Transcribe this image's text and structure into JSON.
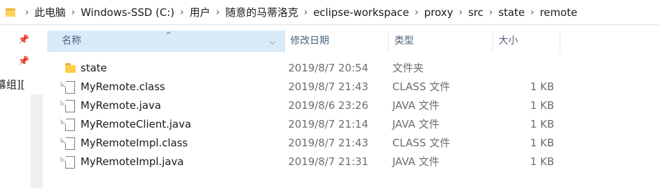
{
  "address_bar": {
    "crumbs": [
      "此电脑",
      "Windows-SSD (C:)",
      "用户",
      "随意的马蒂洛克",
      "eclipse-workspace",
      "proxy",
      "src",
      "state",
      "remote"
    ]
  },
  "nav_pane": {
    "label": "幕组]["
  },
  "columns": {
    "name": "名称",
    "date": "修改日期",
    "type": "类型",
    "size": "大小"
  },
  "files": [
    {
      "name": "state",
      "date": "2019/8/7 20:54",
      "type": "文件夹",
      "size": "",
      "icon": "folder-icon"
    },
    {
      "name": "MyRemote.class",
      "date": "2019/8/7 21:43",
      "type": "CLASS 文件",
      "size": "1 KB",
      "icon": "file-icon"
    },
    {
      "name": "MyRemote.java",
      "date": "2019/8/6 23:26",
      "type": "JAVA 文件",
      "size": "1 KB",
      "icon": "file-icon"
    },
    {
      "name": "MyRemoteClient.java",
      "date": "2019/8/7 21:14",
      "type": "JAVA 文件",
      "size": "1 KB",
      "icon": "file-icon"
    },
    {
      "name": "MyRemoteImpl.class",
      "date": "2019/8/7 21:43",
      "type": "CLASS 文件",
      "size": "1 KB",
      "icon": "file-icon"
    },
    {
      "name": "MyRemoteImpl.java",
      "date": "2019/8/7 21:31",
      "type": "JAVA 文件",
      "size": "1 KB",
      "icon": "file-icon"
    }
  ],
  "colors": {
    "header_selected": "#d9ebf9",
    "folder": "#ffcf4a",
    "header_text": "#4c607a"
  }
}
